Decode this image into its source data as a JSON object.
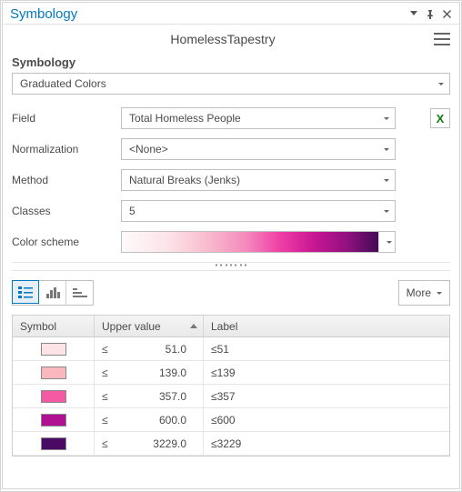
{
  "pane": {
    "title": "Symbology"
  },
  "header": {
    "layer_name": "HomelessTapestry"
  },
  "section": {
    "label": "Symbology"
  },
  "primary_selector": {
    "value": "Graduated Colors"
  },
  "fields": {
    "field": {
      "label": "Field",
      "value": "Total Homeless People"
    },
    "normalization": {
      "label": "Normalization",
      "value": "<None>"
    },
    "method": {
      "label": "Method",
      "value": "Natural Breaks (Jenks)"
    },
    "classes": {
      "label": "Classes",
      "value": "5"
    },
    "color_scheme": {
      "label": "Color scheme"
    }
  },
  "expression_btn": {
    "glyph": "X"
  },
  "more_btn": {
    "label": "More"
  },
  "table": {
    "headers": {
      "symbol": "Symbol",
      "upper": "Upper value",
      "label": "Label"
    },
    "rows": [
      {
        "color": "#fde3e4",
        "op": "≤",
        "upper": "51.0",
        "label": "≤51"
      },
      {
        "color": "#f9b8bd",
        "op": "≤",
        "upper": "139.0",
        "label": "≤139"
      },
      {
        "color": "#f25aa3",
        "op": "≤",
        "upper": "357.0",
        "label": "≤357"
      },
      {
        "color": "#b01192",
        "op": "≤",
        "upper": "600.0",
        "label": "≤600"
      },
      {
        "color": "#4b0a63",
        "op": "≤",
        "upper": "3229.0",
        "label": "≤3229"
      }
    ]
  },
  "icons": {
    "classes_view": "classes-view",
    "histogram_view": "histogram-view",
    "scales_view": "scales-view"
  }
}
